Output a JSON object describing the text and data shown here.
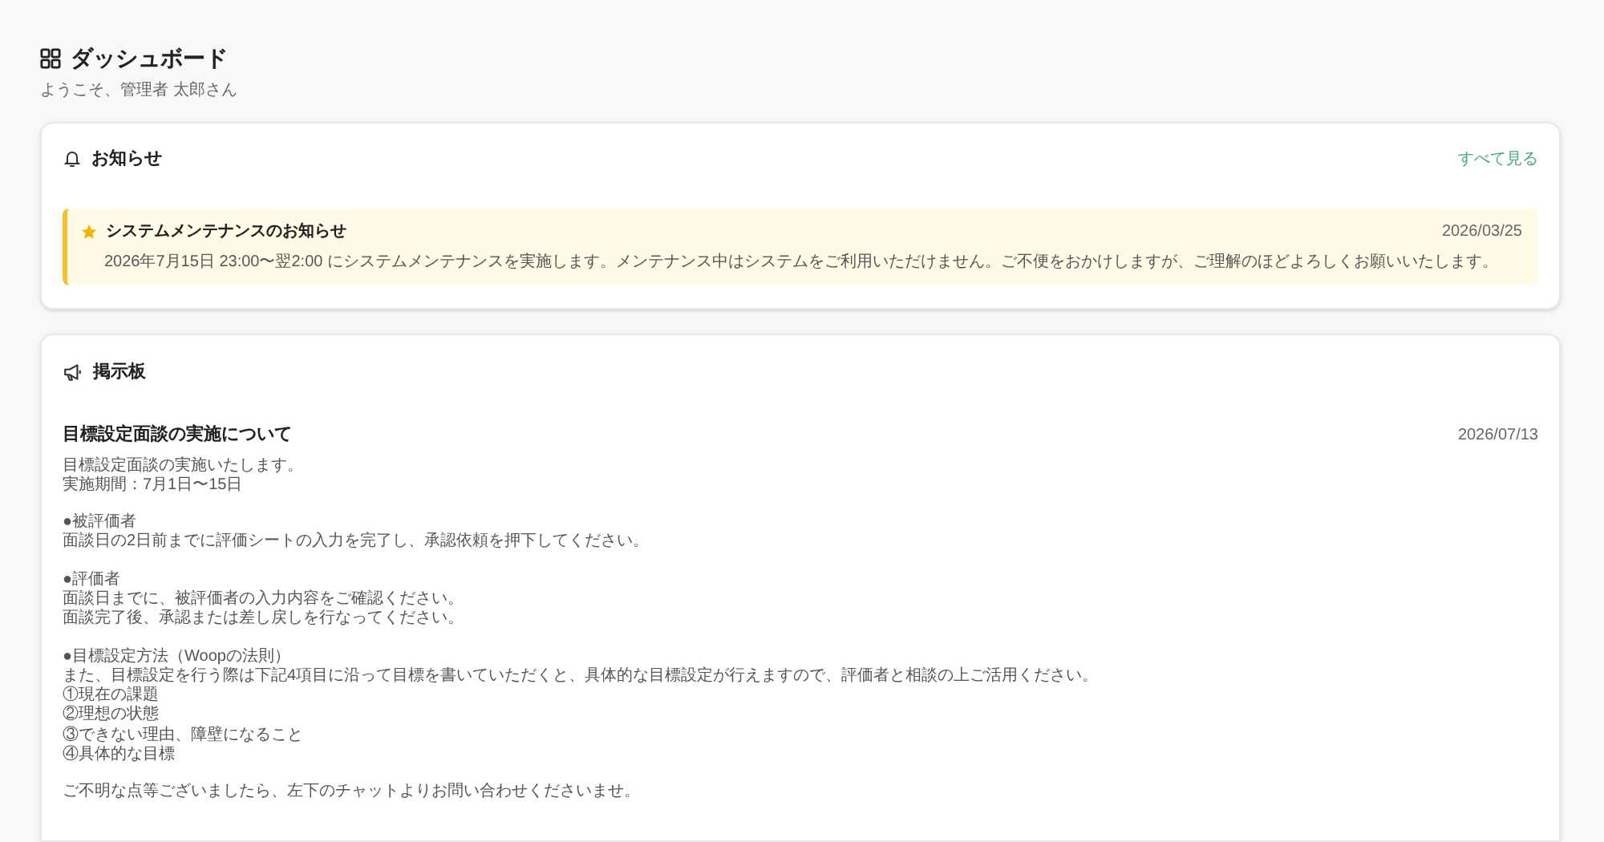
{
  "header": {
    "title": "ダッシュボード",
    "subtitle": "ようこそ、管理者 太郎さん"
  },
  "notices": {
    "title": "お知らせ",
    "view_all": "すべて見る",
    "items": [
      {
        "pinned": true,
        "title": "システムメンテナンスのお知らせ",
        "date": "2026/03/25",
        "body": "2026年7月15日 23:00〜翌2:00 にシステムメンテナンスを実施します。メンテナンス中はシステムをご利用いただけません。ご不便をおかけしますが、ご理解のほどよろしくお願いいたします。"
      }
    ]
  },
  "board": {
    "title": "掲示板",
    "posts": [
      {
        "title": "目標設定面談の実施について",
        "date": "2026/07/13",
        "paragraphs": [
          [
            "目標設定面談の実施いたします。",
            "実施期間：7月1日〜15日"
          ],
          [
            "●被評価者",
            "面談日の2日前までに評価シートの入力を完了し、承認依頼を押下してください。"
          ],
          [
            "●評価者",
            "面談日までに、被評価者の入力内容をご確認ください。",
            "面談完了後、承認または差し戻しを行なってください。"
          ],
          [
            "●目標設定方法（Woopの法則）",
            "また、目標設定を行う際は下記4項目に沿って目標を書いていただくと、具体的な目標設定が行えますので、評価者と相談の上ご活用ください。",
            "①現在の課題",
            "②理想の状態",
            "③できない理由、障壁になること",
            "④具体的な目標"
          ],
          [
            "ご不明な点等ございましたら、左下のチャットよりお問い合わせくださいませ。"
          ]
        ]
      }
    ]
  }
}
